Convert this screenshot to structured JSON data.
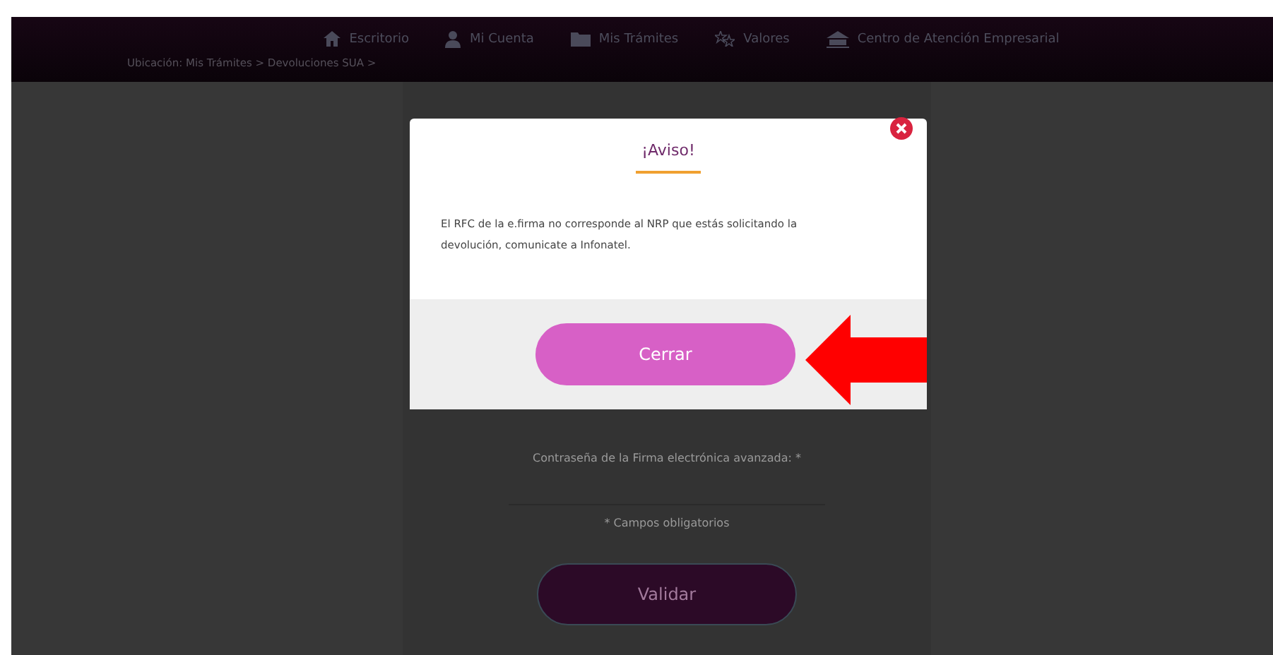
{
  "nav": {
    "items": [
      {
        "label": "Escritorio"
      },
      {
        "label": "Mi Cuenta"
      },
      {
        "label": "Mis Trámites"
      },
      {
        "label": "Valores"
      },
      {
        "label": "Centro de Atención Empresarial"
      }
    ]
  },
  "breadcrumb": "Ubicación: Mis Trámites > Devoluciones SUA >",
  "form": {
    "password_label": "Contraseña de la Firma electrónica avanzada: *",
    "required_note": "* Campos obligatorios",
    "submit": "Validar"
  },
  "modal": {
    "title": "¡Aviso!",
    "message": "El RFC de la e.firma no corresponde al NRP que estás solicitando la devolución, comunicate a Infonatel.",
    "button": "Cerrar"
  }
}
